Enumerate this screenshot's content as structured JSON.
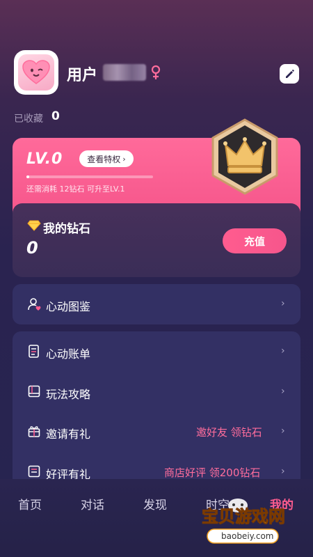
{
  "profile": {
    "username": "用户",
    "favorites_label": "已收藏",
    "favorites_count": "0"
  },
  "level": {
    "label": "LV.0",
    "privilege_button": "查看特权",
    "progress_fraction": 0.0,
    "hint": "还需消耗 12钻石 可升至LV.1"
  },
  "diamond": {
    "title": "我的钻石",
    "count": "0",
    "recharge_label": "充值"
  },
  "menu": {
    "gallery": "心动图鉴",
    "bill": "心动账单",
    "guide": "玩法攻略",
    "invite": "邀请有礼",
    "invite_extra": "邀好友 领钻石",
    "review": "好评有礼",
    "review_extra": "商店好评 领200钻石"
  },
  "tabs": {
    "home": "首页",
    "chat": "对话",
    "discover": "发现",
    "moment": "时空",
    "mine": "我的"
  },
  "watermark": {
    "title": "宝贝游戏网",
    "url": "baobeiy.com"
  },
  "colors": {
    "accent": "#ff5c8f",
    "card": "#333064"
  }
}
